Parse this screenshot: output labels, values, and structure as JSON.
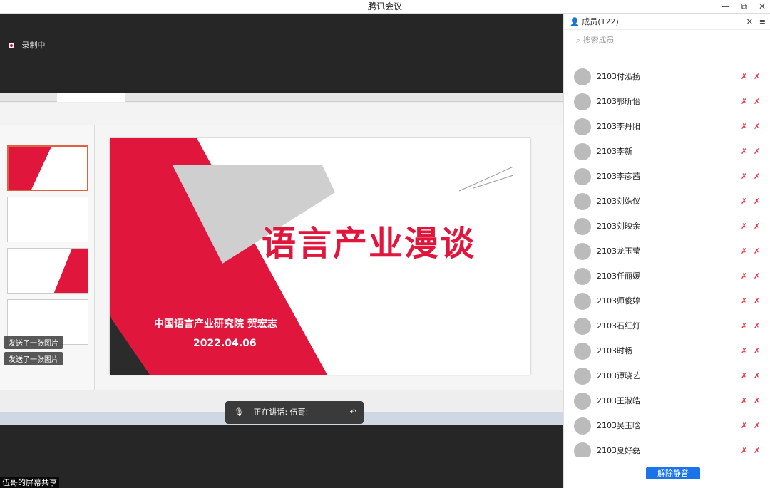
{
  "window": {
    "title": "腾讯会议",
    "min_icon": "minimize-icon",
    "restore_icon": "restore-icon",
    "close_icon": "close-icon"
  },
  "recording": {
    "label": "录制中"
  },
  "slide": {
    "title": "语言产业漫谈",
    "org": "中国语言产业研究院 贺宏志",
    "date": "2022.04.06"
  },
  "chat": {
    "msg1": "发送了一张图片",
    "msg2": "发送了一张图片"
  },
  "speaking": {
    "label": "正在讲话: 伍哥;"
  },
  "share": {
    "label": "伍哥的屏幕共享"
  },
  "members": {
    "title": "成员(122)",
    "search_placeholder": "搜索成员",
    "unmute_label": "解除静音"
  },
  "participants": [
    {
      "name": "2103付泓扬"
    },
    {
      "name": "2103郭昕怡"
    },
    {
      "name": "2103李丹阳"
    },
    {
      "name": "2103李新"
    },
    {
      "name": "2103李彦茜"
    },
    {
      "name": "2103刘姝仪"
    },
    {
      "name": "2103刘映余"
    },
    {
      "name": "2103龙玉莹"
    },
    {
      "name": "2103任丽媛"
    },
    {
      "name": "2103师俊婷"
    },
    {
      "name": "2103石红灯"
    },
    {
      "name": "2103时畅"
    },
    {
      "name": "2103谭晓艺"
    },
    {
      "name": "2103王淑皓"
    },
    {
      "name": "2103吴玉晗"
    },
    {
      "name": "2103夏好磊"
    }
  ]
}
